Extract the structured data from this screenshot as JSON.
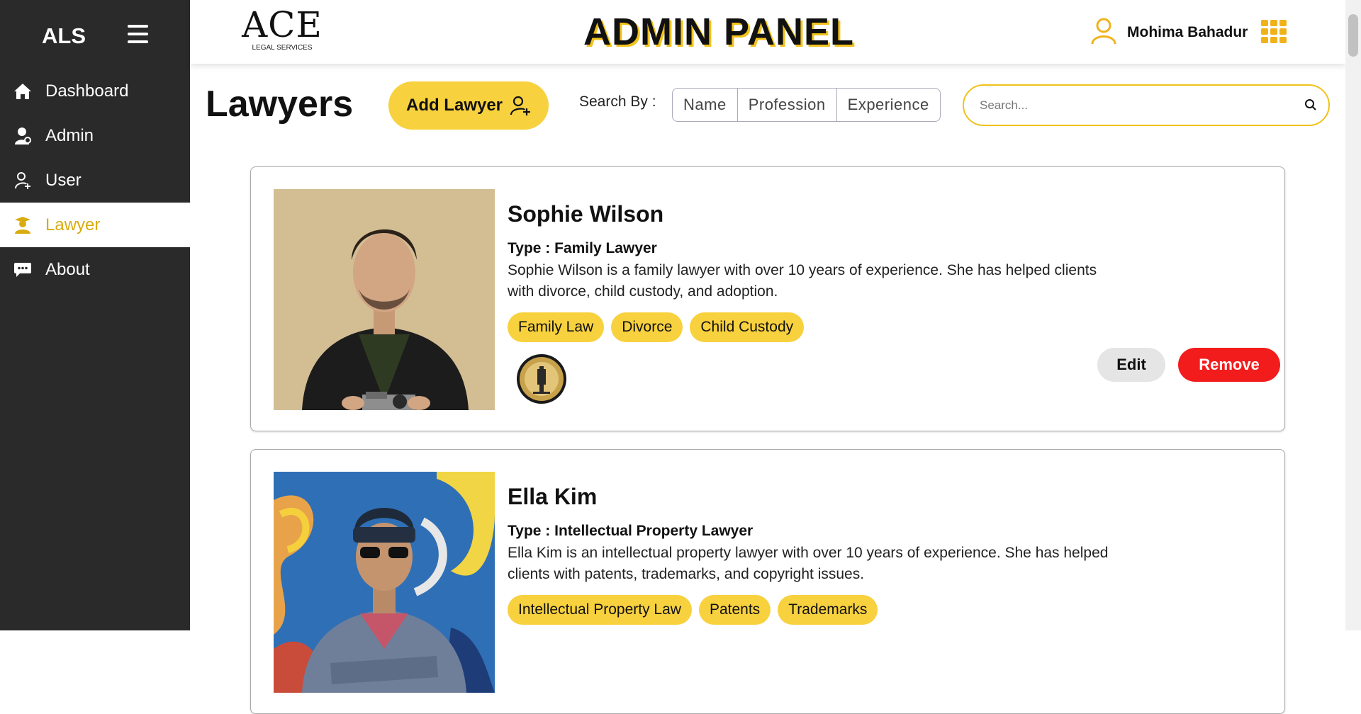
{
  "sidebar": {
    "brand": "ALS",
    "items": [
      {
        "label": "Dashboard",
        "icon": "home-icon"
      },
      {
        "label": "Admin",
        "icon": "admin-icon"
      },
      {
        "label": "User",
        "icon": "user-add-icon"
      },
      {
        "label": "Lawyer",
        "icon": "graduate-icon",
        "active": true
      },
      {
        "label": "About",
        "icon": "chat-icon"
      }
    ]
  },
  "header": {
    "logo_main": "ACE",
    "logo_sub": "LEGAL SERVICES",
    "title": "ADMIN PANEL",
    "user_name": "Mohima Bahadur"
  },
  "toolbar": {
    "page_title": "Lawyers",
    "add_label": "Add Lawyer",
    "search_by_label": "Search By :",
    "filters": [
      "Name",
      "Profession",
      "Experience"
    ],
    "search_placeholder": "Search..."
  },
  "lawyers": [
    {
      "name": "Sophie Wilson",
      "type": "Type : Family Lawyer",
      "description": "Sophie Wilson is a family lawyer with over 10 years of experience. She has helped clients with divorce, child custody, and adoption.",
      "tags": [
        "Family Law",
        "Divorce",
        "Child Custody"
      ],
      "badge_text": "THE NATIONAL BLACK LAWYERS",
      "edit_label": "Edit",
      "remove_label": "Remove"
    },
    {
      "name": "Ella Kim",
      "type": "Type : Intellectual Property Lawyer",
      "description": "Ella Kim is an intellectual property lawyer with over 10 years of experience. She has helped clients with patents, trademarks, and copyright issues.",
      "tags": [
        "Intellectual Property Law",
        "Patents",
        "Trademarks"
      ],
      "edit_label": "Edit",
      "remove_label": "Remove"
    }
  ],
  "colors": {
    "accent": "#f8d13f",
    "sidebar_bg": "#2a2a2a",
    "active_text": "#d8ac10",
    "danger": "#f21c1c"
  }
}
